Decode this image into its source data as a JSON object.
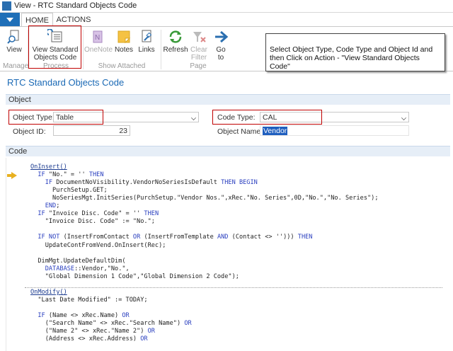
{
  "window": {
    "title": "View - RTC Standard Objects Code"
  },
  "tabs": [
    {
      "label": "HOME"
    },
    {
      "label": "ACTIONS"
    }
  ],
  "ribbon": {
    "buttons": {
      "view": "View",
      "view_std_1": "View Standard",
      "view_std_2": "Objects Code",
      "onenote": "OneNote",
      "notes": "Notes",
      "links": "Links",
      "refresh": "Refresh",
      "clear_1": "Clear",
      "clear_2": "Filter",
      "goto_1": "Go",
      "goto_2": "to"
    },
    "groups": {
      "manage": "Manage",
      "process": "Process",
      "show_attached": "Show Attached",
      "page": "Page"
    }
  },
  "callout": {
    "text": "Select Object Type, Code Type and Object Id and then Click on Action - \"View Standard Objects Code\""
  },
  "page": {
    "title": "RTC Standard Objects Code"
  },
  "object_section": {
    "header": "Object",
    "object_type_label": "Object Type:",
    "object_type_value": "Table",
    "code_type_label": "Code Type:",
    "code_type_value": "CAL",
    "object_id_label": "Object ID:",
    "object_id_value": "23",
    "object_name_label": "Object Name:",
    "object_name_value": "Vendor"
  },
  "code_section": {
    "header": "Code",
    "lines": [
      "OnInsert()",
      "  IF \"No.\" = '' THEN",
      "    IF DocumentNoVisibility.VendorNoSeriesIsDefault THEN BEGIN",
      "      PurchSetup.GET;",
      "      NoSeriesMgt.InitSeries(PurchSetup.\"Vendor Nos.\",xRec.\"No. Series\",0D,\"No.\",\"No. Series\");",
      "    END;",
      "  IF \"Invoice Disc. Code\" = '' THEN",
      "    \"Invoice Disc. Code\" := \"No.\";",
      "",
      "  IF NOT (InsertFromContact OR (InsertFromTemplate AND (Contact <> ''))) THEN",
      "    UpdateContFromVend.OnInsert(Rec);",
      "",
      "  DimMgt.UpdateDefaultDim(",
      "    DATABASE::Vendor,\"No.\",",
      "    \"Global Dimension 1 Code\",\"Global Dimension 2 Code\");",
      "",
      "OnModify()",
      "  \"Last Date Modified\" := TODAY;",
      "",
      "  IF (Name <> xRec.Name) OR",
      "    (\"Search Name\" <> xRec.\"Search Name\") OR",
      "    (\"Name 2\" <> xRec.\"Name 2\") OR",
      "    (Address <> xRec.Address) OR"
    ]
  },
  "colors": {
    "accent": "#1a69b5",
    "highlight_border": "#c00000",
    "section_bg": "#e6eef7"
  }
}
